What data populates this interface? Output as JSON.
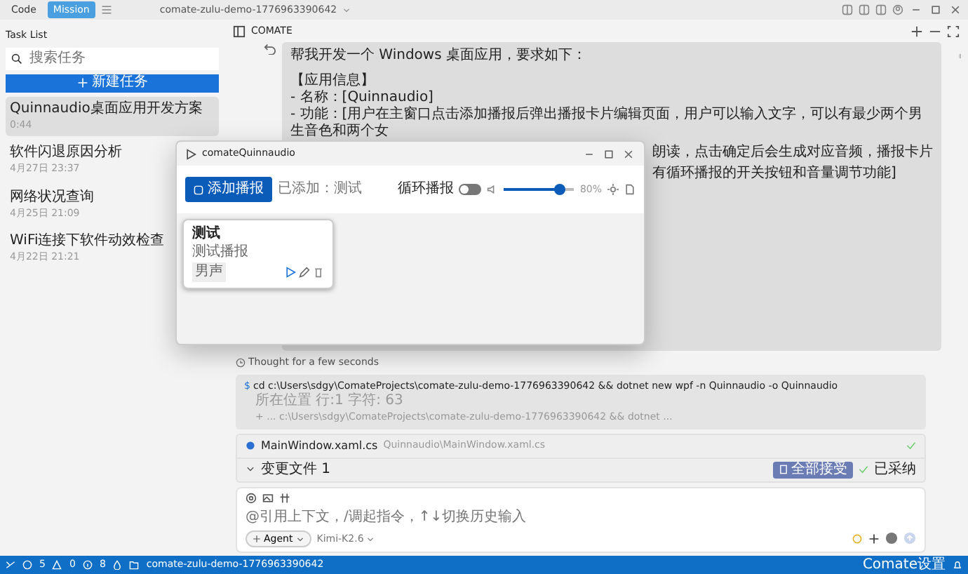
{
  "topbar": {
    "modes": [
      {
        "label": "Code",
        "selected": false
      },
      {
        "label": "Mission",
        "selected": true
      }
    ],
    "project": "comate-zulu-demo-1776963390642"
  },
  "sidebar": {
    "title": "Task List",
    "search": {
      "placeholder": "搜索任务"
    },
    "new_button": "新建任务",
    "tasks": [
      {
        "title": "Quinnaudio桌面应用开发方案",
        "time": "0:44",
        "selected": true
      },
      {
        "title": "软件闪退原因分析",
        "time": "4月27日 23:37",
        "selected": false
      },
      {
        "title": "网络状况查询",
        "time": "4月25日 21:09",
        "selected": false
      },
      {
        "title": "WiFi连接下软件动效检查",
        "time": "4月22日 21:21",
        "selected": false
      }
    ]
  },
  "chat": {
    "header": "COMATE",
    "message": {
      "lines": [
        "帮我开发一个 Windows 桌面应用，要求如下：",
        "【应用信息】",
        "- 名称：[Quinnaudio]",
        "- 功能：[用户在主窗口点击添加播报后弹出播报卡片编辑页面，用户可以输入文字，可以有最少两个男生音色和两个女"
      ],
      "tail_lines": [
        "朗读，点击确定后会生成对应音频，播报卡片",
        "有循环播报的开关按钮和音量调节功能]"
      ]
    },
    "thought": "Thought for a few seconds",
    "command": {
      "prompt": "$",
      "text": "cd c:\\Users\\sdgy\\ComateProjects\\comate-zulu-demo-1776963390642 && dotnet new wpf -n Quinnaudio -o Quinnaudio",
      "meta": "所在位置 行:1 字符: 63",
      "output": "+ ... c:\\Users\\sdgy\\ComateProjects\\comate-zulu-demo-1776963390642 && dotnet ..."
    },
    "changes": {
      "file": "MainWindow.xaml.cs",
      "path": "Quinnaudio\\MainWindow.xaml.cs",
      "title": "变更文件 1",
      "expanded": true,
      "accept_all": "全部接受",
      "accepted": "已采纳"
    },
    "input": {
      "placeholder": "@引用上下文，/调起指令，↑↓切换历史输入",
      "mode": "Agent",
      "model": "Kimi-K2.6"
    }
  },
  "app_window": {
    "title": "comateQuinnaudio",
    "add_button": "添加播报",
    "added": "已添加：测试",
    "loop": {
      "label": "循环播报",
      "on": false
    },
    "volume": {
      "level": 0.8,
      "reading": "80%"
    },
    "cards": [
      {
        "title": "测试",
        "text": "测试播报",
        "tag": "男声"
      }
    ]
  },
  "status_bar": {
    "errors": "5",
    "warnings": "0",
    "info": "8",
    "folder": "comate-zulu-demo-1776963390642",
    "settings": "Comate设置"
  }
}
